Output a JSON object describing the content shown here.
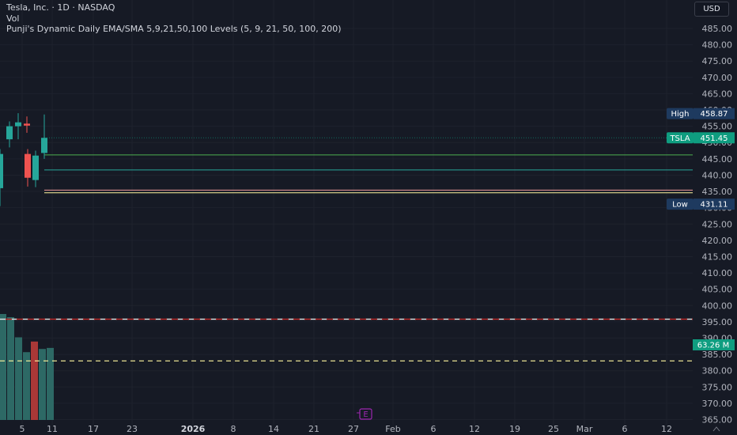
{
  "legend": {
    "symbol_line": "Tesla, Inc. · 1D · NASDAQ",
    "vol_label": "Vol",
    "indicator_label": "Punji's Dynamic Daily EMA/SMA 5,9,21,50,100 Levels (5, 9, 21, 50, 100, 200)"
  },
  "currency": "USD",
  "colors": {
    "up": "#26a69a",
    "down": "#ef5350",
    "background": "#161a25",
    "grid": "#1e222d",
    "badge": "#1e3a5f",
    "last_price": "#0f9d80",
    "event_marker": "#9c27b0"
  },
  "chart_data": {
    "type": "candlestick",
    "price_axis": {
      "ticks": [
        365,
        370,
        375,
        380,
        385,
        390,
        395,
        400,
        405,
        410,
        415,
        420,
        425,
        430,
        435,
        440,
        445,
        450,
        455,
        460,
        465,
        470,
        475,
        480,
        485
      ],
      "ylim": [
        364.5,
        487.6
      ]
    },
    "x_axis": {
      "ticks": [
        {
          "label": "5",
          "bold": false
        },
        {
          "label": "11",
          "bold": false
        },
        {
          "label": "17",
          "bold": false
        },
        {
          "label": "23",
          "bold": false
        },
        {
          "label": "2026",
          "bold": true
        },
        {
          "label": "8",
          "bold": false
        },
        {
          "label": "14",
          "bold": false
        },
        {
          "label": "21",
          "bold": false
        },
        {
          "label": "27",
          "bold": false
        },
        {
          "label": "Feb",
          "bold": false
        },
        {
          "label": "6",
          "bold": false
        },
        {
          "label": "12",
          "bold": false
        },
        {
          "label": "19",
          "bold": false
        },
        {
          "label": "25",
          "bold": false
        },
        {
          "label": "Mar",
          "bold": false
        },
        {
          "label": "6",
          "bold": false
        },
        {
          "label": "12",
          "bold": false
        }
      ]
    },
    "candles": [
      {
        "open": 436,
        "close": 446.5,
        "high": 448,
        "low": 430.5,
        "dir": "up"
      },
      {
        "open": 451,
        "close": 455,
        "high": 456.5,
        "low": 448.5,
        "dir": "up"
      },
      {
        "open": 455,
        "close": 456.2,
        "high": 459,
        "low": 451,
        "dir": "up"
      },
      {
        "open": 455.8,
        "close": 455.2,
        "high": 458,
        "low": 453,
        "dir": "down"
      },
      {
        "open": 446.5,
        "close": 439.2,
        "high": 448,
        "low": 436.5,
        "dir": "down"
      },
      {
        "open": 438.5,
        "close": 446,
        "high": 447.5,
        "low": 436.3,
        "dir": "up"
      },
      {
        "open": 446.8,
        "close": 451.45,
        "high": 458.6,
        "low": 445,
        "dir": "up"
      }
    ],
    "volume_bars": [
      {
        "value": 100,
        "dir": "up"
      },
      {
        "value": 97,
        "dir": "up"
      },
      {
        "value": 78,
        "dir": "up"
      },
      {
        "value": 64,
        "dir": "up"
      },
      {
        "value": 74,
        "dir": "down"
      },
      {
        "value": 67,
        "dir": "up"
      },
      {
        "value": 68,
        "dir": "up"
      }
    ],
    "levels": [
      {
        "price": 446.2,
        "color": "#4caf50"
      },
      {
        "price": 441.6,
        "color": "#26a69a"
      },
      {
        "price": 435.4,
        "color": "#ef9a9a"
      },
      {
        "price": 434.6,
        "color": "#fff59d"
      }
    ],
    "dashed_levels": [
      {
        "price": 395.8,
        "color": "#c62828",
        "style": "red-white"
      },
      {
        "price": 383.0,
        "color": "#fff59d",
        "style": "yellow"
      }
    ],
    "markers": {
      "high": {
        "label": "High",
        "value": "458.87",
        "price": 458.87
      },
      "last": {
        "label": "TSLA",
        "value": "451.45",
        "price": 451.45
      },
      "low": {
        "label": "Low",
        "value": "431.11",
        "price": 431.11
      },
      "volume": {
        "value": "63.26 M"
      }
    },
    "event_marker": {
      "label": "E"
    }
  }
}
